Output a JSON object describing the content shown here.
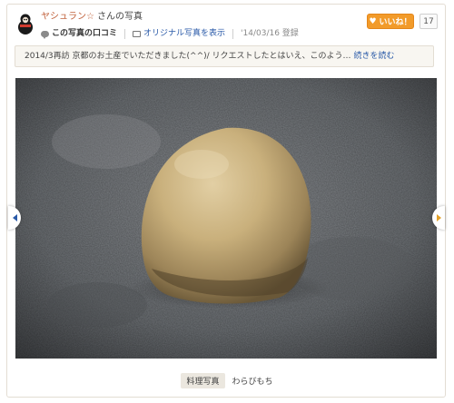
{
  "author": {
    "name": "ヤシュラン☆",
    "suffix": "さんの写真"
  },
  "meta": {
    "review_link": "この写真の口コミ",
    "original_link": "オリジナル写真を表示",
    "date": "'14/03/16 登録"
  },
  "like": {
    "label": "いいね！",
    "count": "17"
  },
  "caption": {
    "text": "2014/3再訪 京都のお土産でいただきました(^^)/ リクエストしたとはいえ、このよう…",
    "read_more": "続きを読む"
  },
  "photo": {
    "subject": "warabi-mochi"
  },
  "footer": {
    "category": "料理写真",
    "dish": "わらびもち"
  },
  "colors": {
    "accent": "#f29b2a",
    "link": "#2a5aa8",
    "author": "#c0603a"
  }
}
